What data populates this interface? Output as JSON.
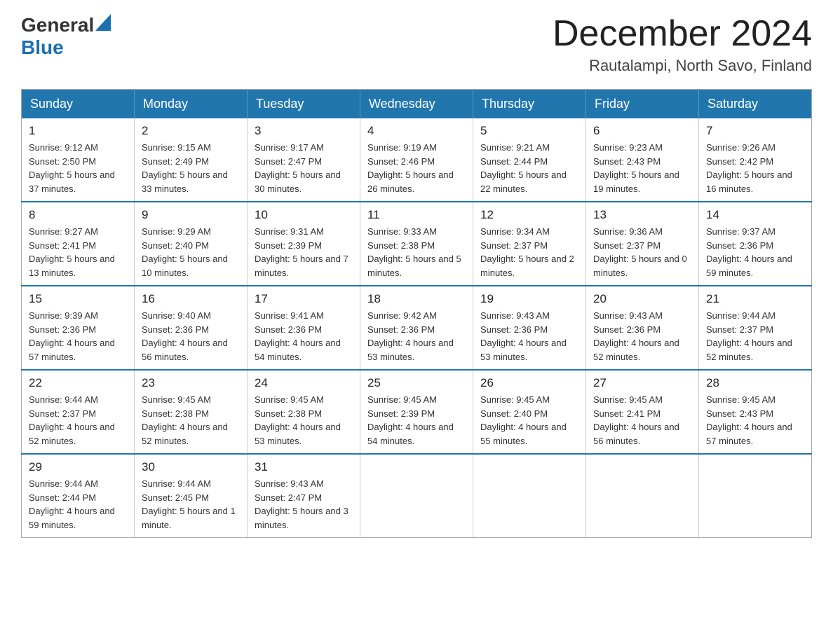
{
  "header": {
    "logo_general": "General",
    "logo_blue": "Blue",
    "month_title": "December 2024",
    "location": "Rautalampi, North Savo, Finland"
  },
  "days_of_week": [
    "Sunday",
    "Monday",
    "Tuesday",
    "Wednesday",
    "Thursday",
    "Friday",
    "Saturday"
  ],
  "weeks": [
    [
      {
        "day": "1",
        "sunrise": "9:12 AM",
        "sunset": "2:50 PM",
        "daylight": "5 hours and 37 minutes."
      },
      {
        "day": "2",
        "sunrise": "9:15 AM",
        "sunset": "2:49 PM",
        "daylight": "5 hours and 33 minutes."
      },
      {
        "day": "3",
        "sunrise": "9:17 AM",
        "sunset": "2:47 PM",
        "daylight": "5 hours and 30 minutes."
      },
      {
        "day": "4",
        "sunrise": "9:19 AM",
        "sunset": "2:46 PM",
        "daylight": "5 hours and 26 minutes."
      },
      {
        "day": "5",
        "sunrise": "9:21 AM",
        "sunset": "2:44 PM",
        "daylight": "5 hours and 22 minutes."
      },
      {
        "day": "6",
        "sunrise": "9:23 AM",
        "sunset": "2:43 PM",
        "daylight": "5 hours and 19 minutes."
      },
      {
        "day": "7",
        "sunrise": "9:26 AM",
        "sunset": "2:42 PM",
        "daylight": "5 hours and 16 minutes."
      }
    ],
    [
      {
        "day": "8",
        "sunrise": "9:27 AM",
        "sunset": "2:41 PM",
        "daylight": "5 hours and 13 minutes."
      },
      {
        "day": "9",
        "sunrise": "9:29 AM",
        "sunset": "2:40 PM",
        "daylight": "5 hours and 10 minutes."
      },
      {
        "day": "10",
        "sunrise": "9:31 AM",
        "sunset": "2:39 PM",
        "daylight": "5 hours and 7 minutes."
      },
      {
        "day": "11",
        "sunrise": "9:33 AM",
        "sunset": "2:38 PM",
        "daylight": "5 hours and 5 minutes."
      },
      {
        "day": "12",
        "sunrise": "9:34 AM",
        "sunset": "2:37 PM",
        "daylight": "5 hours and 2 minutes."
      },
      {
        "day": "13",
        "sunrise": "9:36 AM",
        "sunset": "2:37 PM",
        "daylight": "5 hours and 0 minutes."
      },
      {
        "day": "14",
        "sunrise": "9:37 AM",
        "sunset": "2:36 PM",
        "daylight": "4 hours and 59 minutes."
      }
    ],
    [
      {
        "day": "15",
        "sunrise": "9:39 AM",
        "sunset": "2:36 PM",
        "daylight": "4 hours and 57 minutes."
      },
      {
        "day": "16",
        "sunrise": "9:40 AM",
        "sunset": "2:36 PM",
        "daylight": "4 hours and 56 minutes."
      },
      {
        "day": "17",
        "sunrise": "9:41 AM",
        "sunset": "2:36 PM",
        "daylight": "4 hours and 54 minutes."
      },
      {
        "day": "18",
        "sunrise": "9:42 AM",
        "sunset": "2:36 PM",
        "daylight": "4 hours and 53 minutes."
      },
      {
        "day": "19",
        "sunrise": "9:43 AM",
        "sunset": "2:36 PM",
        "daylight": "4 hours and 53 minutes."
      },
      {
        "day": "20",
        "sunrise": "9:43 AM",
        "sunset": "2:36 PM",
        "daylight": "4 hours and 52 minutes."
      },
      {
        "day": "21",
        "sunrise": "9:44 AM",
        "sunset": "2:37 PM",
        "daylight": "4 hours and 52 minutes."
      }
    ],
    [
      {
        "day": "22",
        "sunrise": "9:44 AM",
        "sunset": "2:37 PM",
        "daylight": "4 hours and 52 minutes."
      },
      {
        "day": "23",
        "sunrise": "9:45 AM",
        "sunset": "2:38 PM",
        "daylight": "4 hours and 52 minutes."
      },
      {
        "day": "24",
        "sunrise": "9:45 AM",
        "sunset": "2:38 PM",
        "daylight": "4 hours and 53 minutes."
      },
      {
        "day": "25",
        "sunrise": "9:45 AM",
        "sunset": "2:39 PM",
        "daylight": "4 hours and 54 minutes."
      },
      {
        "day": "26",
        "sunrise": "9:45 AM",
        "sunset": "2:40 PM",
        "daylight": "4 hours and 55 minutes."
      },
      {
        "day": "27",
        "sunrise": "9:45 AM",
        "sunset": "2:41 PM",
        "daylight": "4 hours and 56 minutes."
      },
      {
        "day": "28",
        "sunrise": "9:45 AM",
        "sunset": "2:43 PM",
        "daylight": "4 hours and 57 minutes."
      }
    ],
    [
      {
        "day": "29",
        "sunrise": "9:44 AM",
        "sunset": "2:44 PM",
        "daylight": "4 hours and 59 minutes."
      },
      {
        "day": "30",
        "sunrise": "9:44 AM",
        "sunset": "2:45 PM",
        "daylight": "5 hours and 1 minute."
      },
      {
        "day": "31",
        "sunrise": "9:43 AM",
        "sunset": "2:47 PM",
        "daylight": "5 hours and 3 minutes."
      },
      null,
      null,
      null,
      null
    ]
  ]
}
